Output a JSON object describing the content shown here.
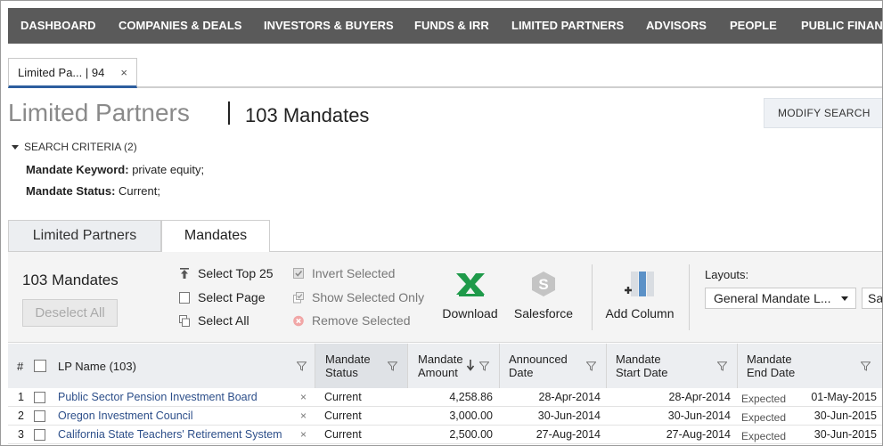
{
  "nav": {
    "items": [
      "DASHBOARD",
      "COMPANIES & DEALS",
      "INVESTORS & BUYERS",
      "FUNDS & IRR",
      "LIMITED PARTNERS",
      "ADVISORS",
      "PEOPLE",
      "PUBLIC FINANCI"
    ]
  },
  "doc_tab": {
    "label": "Limited Pa... | 94",
    "close": "×"
  },
  "header": {
    "title": "Limited Partners",
    "count": "103 Mandates",
    "modify_button": "MODIFY SEARCH"
  },
  "criteria": {
    "toggle": "SEARCH CRITERIA (2)",
    "rows": [
      {
        "label": "Mandate Keyword:",
        "value": "private equity;"
      },
      {
        "label": "Mandate Status:",
        "value": "Current;"
      }
    ]
  },
  "view_tabs": [
    "Limited Partners",
    "Mandates"
  ],
  "toolbar": {
    "count": "103 Mandates",
    "deselect": "Deselect All",
    "select_top": "Select Top 25",
    "select_page": "Select Page",
    "select_all": "Select All",
    "invert": "Invert Selected",
    "show_selected": "Show Selected Only",
    "remove_selected": "Remove Selected",
    "download": "Download",
    "salesforce": "Salesforce",
    "add_column": "Add Column",
    "layouts_label": "Layouts:",
    "layout_value": "General Mandate L...",
    "save": "Save"
  },
  "colors": {
    "nav_bg": "#5a5a5a",
    "excel_green": "#1f9a4a",
    "link_blue": "#2d4f8a",
    "tab_accent": "#2d5e9e"
  },
  "table": {
    "headers": {
      "num": "#",
      "lp_name": "LP Name  (103)",
      "status": [
        "Mandate",
        "Status"
      ],
      "amount": [
        "Mandate",
        "Amount"
      ],
      "announced": [
        "Announced",
        "Date"
      ],
      "start": [
        "Mandate",
        "Start Date"
      ],
      "end": [
        "Mandate",
        "End Date"
      ]
    },
    "rows": [
      {
        "num": "1",
        "lp": "Public Sector Pension Investment Board",
        "status": "Current",
        "amount": "4,258.86",
        "announced": "28-Apr-2014",
        "start": "28-Apr-2014",
        "end_tag": "Expected",
        "end": "01-May-2015"
      },
      {
        "num": "2",
        "lp": "Oregon Investment Council",
        "status": "Current",
        "amount": "3,000.00",
        "announced": "30-Jun-2014",
        "start": "30-Jun-2014",
        "end_tag": "Expected",
        "end": "30-Jun-2015"
      },
      {
        "num": "3",
        "lp": "California State Teachers' Retirement System",
        "status": "Current",
        "amount": "2,500.00",
        "announced": "27-Aug-2014",
        "start": "27-Aug-2014",
        "end_tag": "Expected",
        "end": "30-Jun-2015"
      }
    ]
  }
}
